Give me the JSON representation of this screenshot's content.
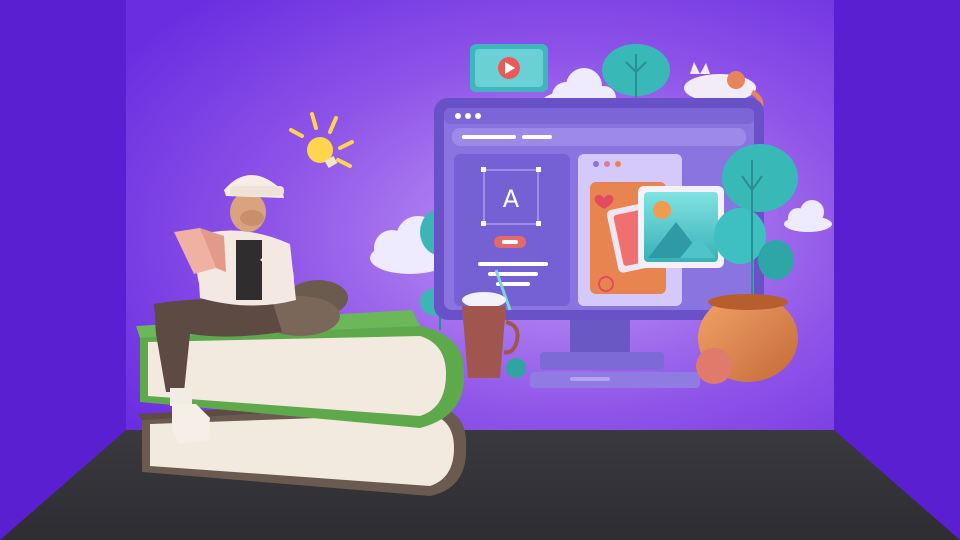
{
  "scene": {
    "editor_letter": "A",
    "colors": {
      "side_wall": "#5a1fd1",
      "back_wall_center": "#a879ee",
      "back_wall_edge": "#6a2ee0",
      "floor": "#3b3a3f",
      "monitor_body": "#6952c8",
      "monitor_screen": "#8a74e0",
      "book_green": "#5fa94d",
      "book_dark": "#6a5a4f",
      "book_pages": "#f3eadf",
      "cloud": "#efeaff",
      "tree": "#39b8b8",
      "pot": "#e28a52"
    },
    "icons": [
      "play-icon",
      "image-icon",
      "lightbulb-icon",
      "heart-icon"
    ]
  }
}
